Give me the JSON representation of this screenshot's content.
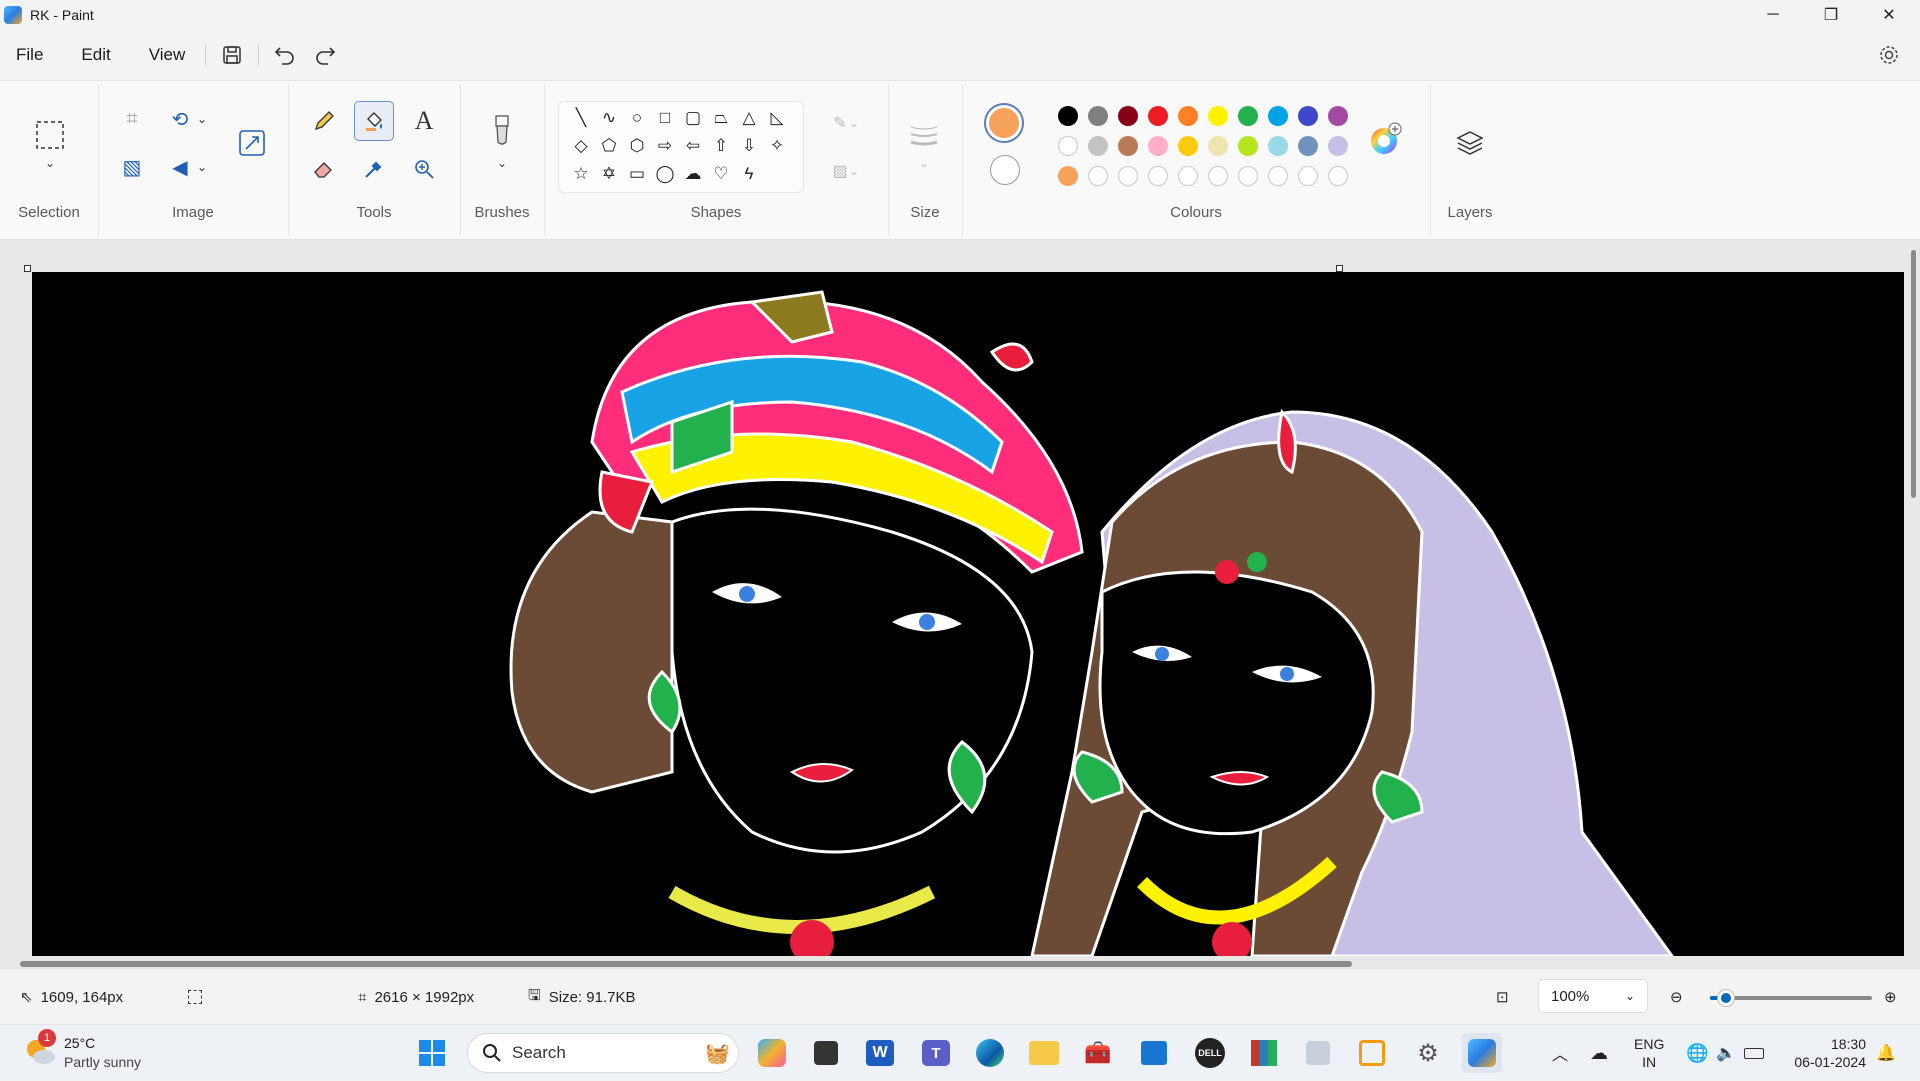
{
  "window": {
    "title": "RK - Paint",
    "minimize_glyph": "─",
    "maximize_glyph": "❐",
    "close_glyph": "✕"
  },
  "menu": {
    "file": "File",
    "edit": "Edit",
    "view": "View"
  },
  "ribbon": {
    "groups": {
      "selection": "Selection",
      "image": "Image",
      "tools": "Tools",
      "brushes": "Brushes",
      "shapes": "Shapes",
      "size": "Size",
      "colours": "Colours",
      "layers": "Layers"
    },
    "primary_color": "#f7a25a",
    "secondary_color": "#ffffff",
    "palette_row1": [
      "#000000",
      "#7f7f7f",
      "#880015",
      "#ed1c24",
      "#ff7f27",
      "#fff200",
      "#22b14c",
      "#00a2e8",
      "#3f48cc",
      "#a349a4"
    ],
    "palette_row2": [
      "#ffffff",
      "#c3c3c3",
      "#b97a57",
      "#ffaec9",
      "#ffc90e",
      "#efe4b0",
      "#b5e61d",
      "#99d9ea",
      "#7092be",
      "#c8bfe7"
    ],
    "palette_row3_filled": [
      "#f7a25a"
    ]
  },
  "status": {
    "cursor_pos": "1609, 164px",
    "canvas_size": "2616 × 1992px",
    "file_size": "Size: 91.7KB",
    "zoom": "100%",
    "zoom_level_fraction": 0.1
  },
  "taskbar": {
    "weather_temp": "25°C",
    "weather_desc": "Partly sunny",
    "weather_badge": "1",
    "search_placeholder": "Search",
    "lang_line1": "ENG",
    "lang_line2": "IN",
    "time": "18:30",
    "date": "06-01-2024"
  }
}
